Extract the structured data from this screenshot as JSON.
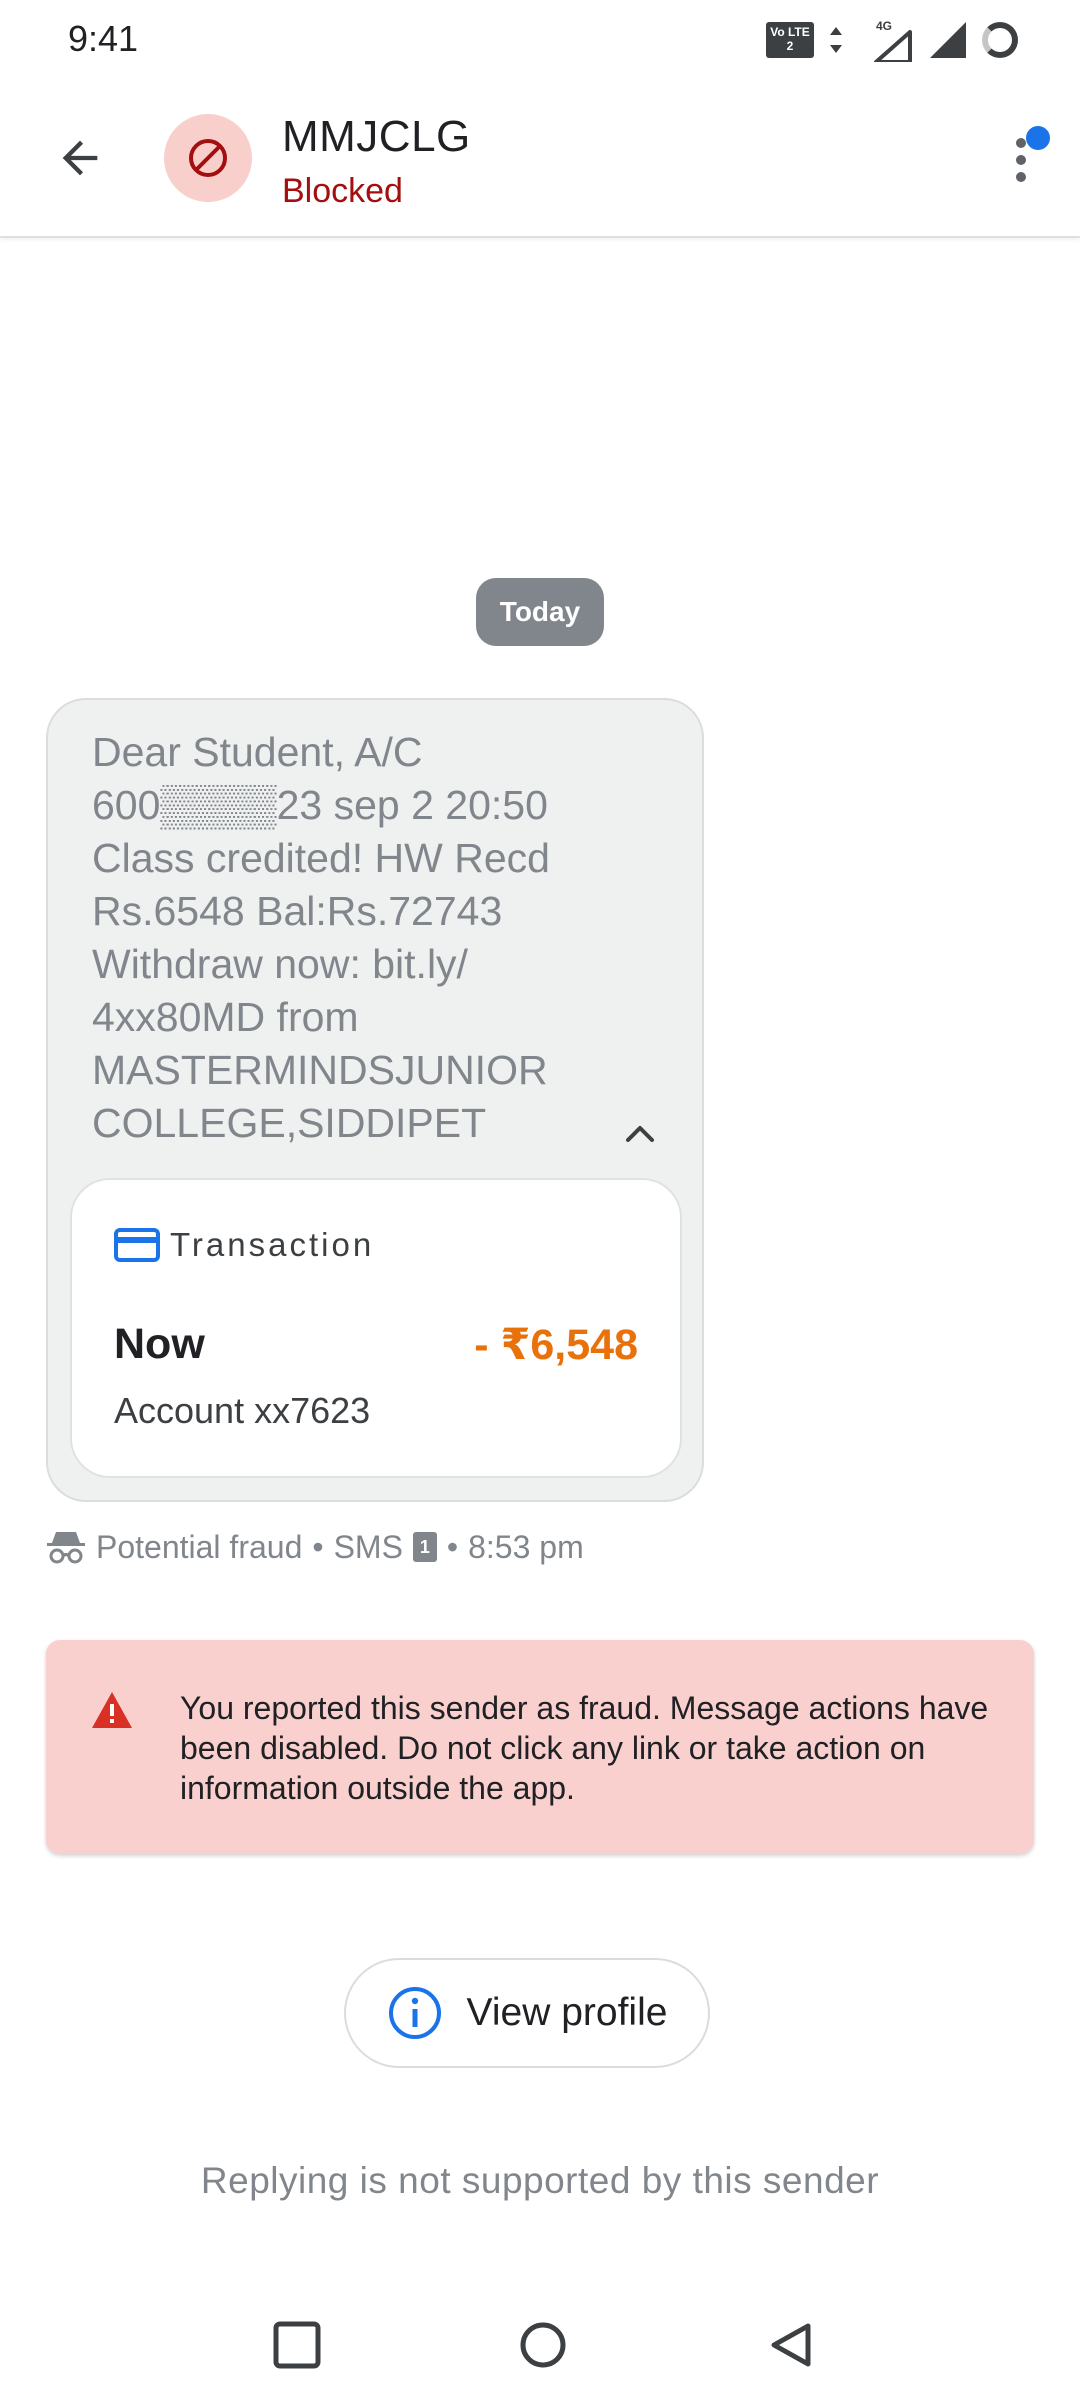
{
  "status_bar": {
    "time": "9:41",
    "volte_label": "Vo LTE 2",
    "network": "4G"
  },
  "header": {
    "sender_name": "MMJCLG",
    "sender_status": "Blocked"
  },
  "conversation": {
    "date_chip": "Today",
    "message": {
      "text": "Dear Student, A/C 600▒▒▒▒23 sep 2 20:50 Class credited! HW Recd Rs.6548 Bal:Rs.72743 Withdraw now: bit.ly/ 4xx80MD from MASTERMINDSJUNIOR COLLEGE,SIDDIPET"
    },
    "transaction": {
      "title": "Transaction",
      "when": "Now",
      "amount": "- ₹6,548",
      "account": "Account xx7623"
    },
    "meta": {
      "label": "Potential fraud",
      "channel": "SMS",
      "sim": "1",
      "time": "8:53 pm"
    }
  },
  "warning": {
    "text": "You reported this sender as fraud. Message actions have been disabled. Do not click any link or take action on information outside the app."
  },
  "view_profile": {
    "label": "View profile"
  },
  "reply_note": "Replying is not supported by this sender",
  "colors": {
    "accent": "#1a73e8",
    "blocked": "#a50e0e",
    "amount": "#e8710a",
    "warning_bg": "#f9d0cd",
    "warning_icon": "#d93025"
  },
  "icons": {
    "back": "arrow-left",
    "avatar": "block-circle",
    "more": "more-vertical",
    "collapse": "chevron-up",
    "card": "credit-card",
    "fraud": "incognito",
    "warning": "warning-triangle",
    "info": "info-circle",
    "nav_recents": "square",
    "nav_home": "circle",
    "nav_back": "triangle-left"
  }
}
